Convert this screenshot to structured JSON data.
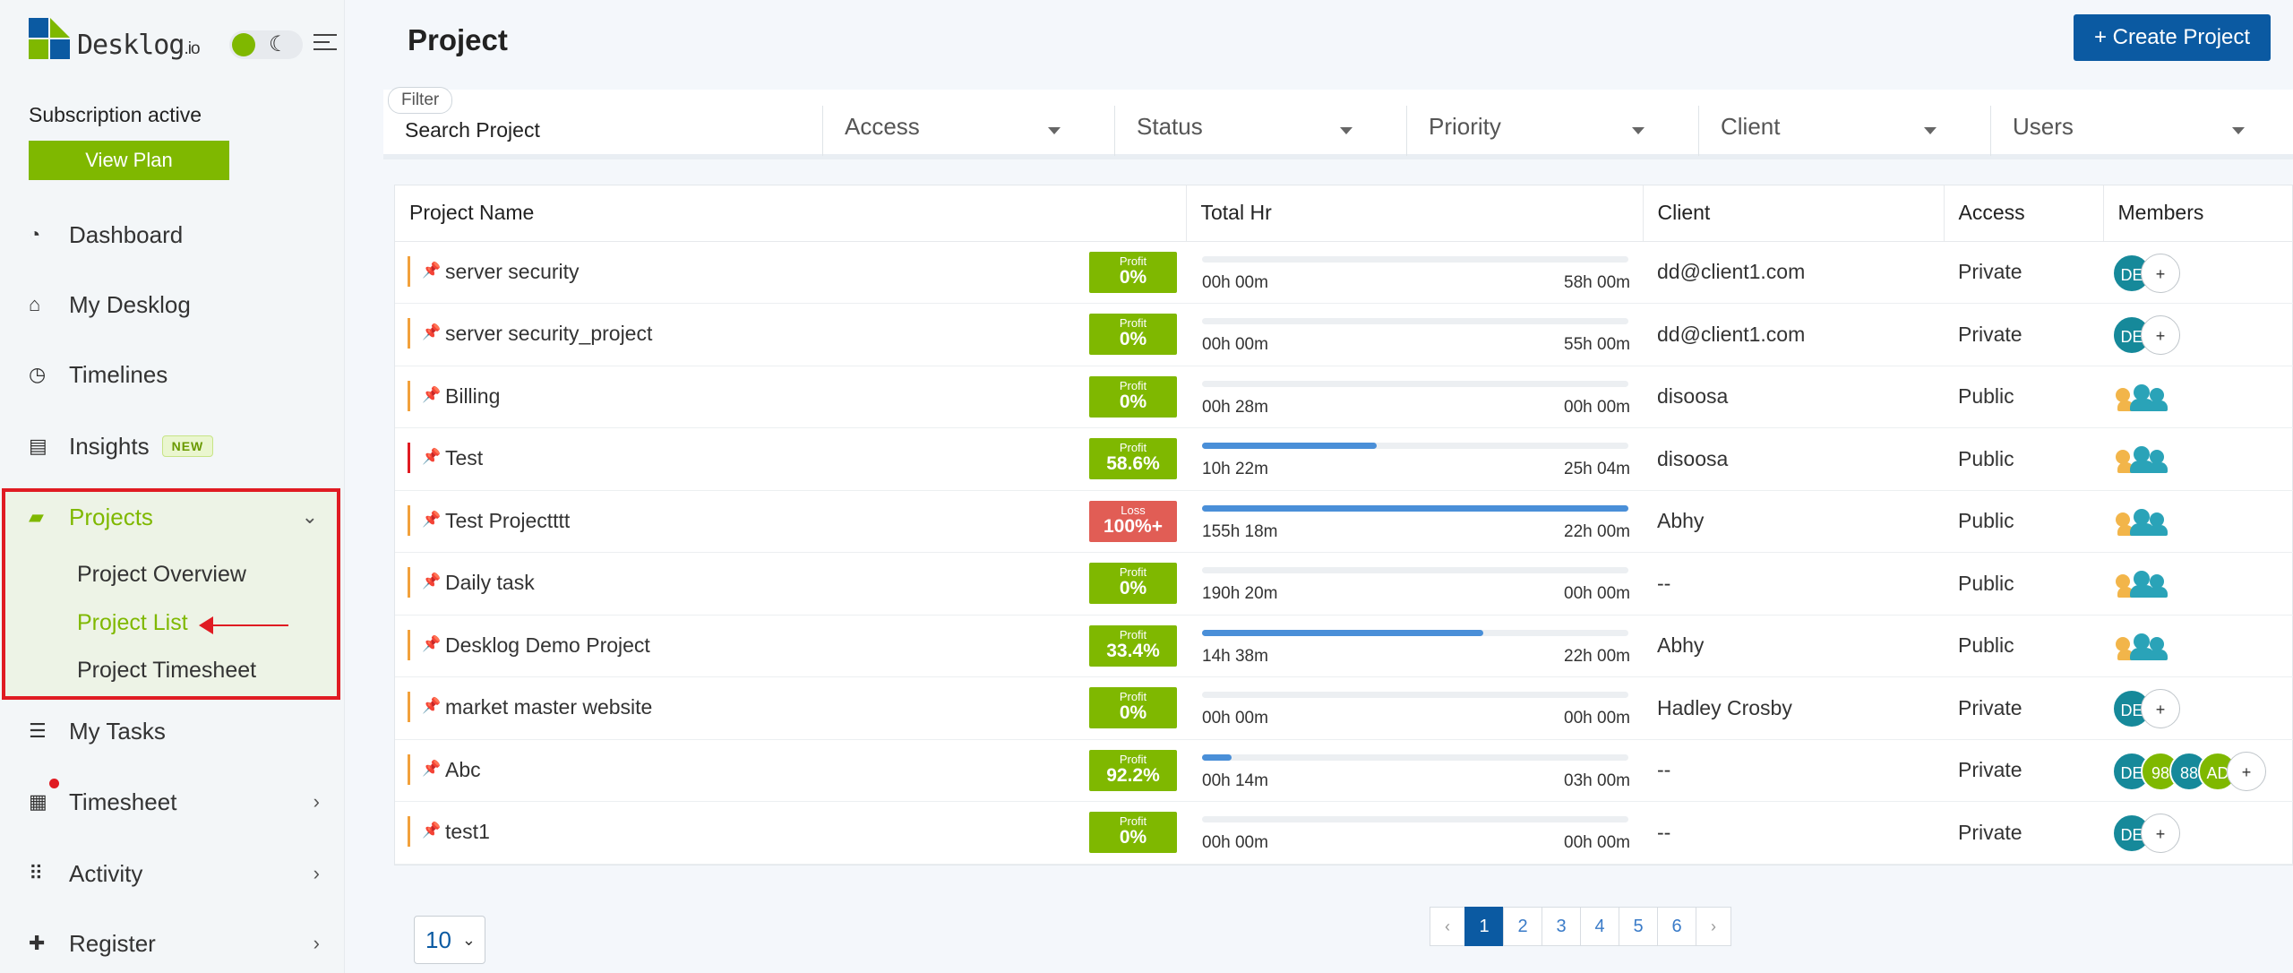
{
  "brand": {
    "name": "Desklog",
    "tld": ".io"
  },
  "sidebar": {
    "subscription_status": "Subscription active",
    "view_plan_label": "View Plan",
    "items": [
      {
        "label": "Dashboard",
        "icon": "dashboard-icon"
      },
      {
        "label": "My Desklog",
        "icon": "home-icon"
      },
      {
        "label": "Timelines",
        "icon": "clock-icon"
      },
      {
        "label": "Insights",
        "icon": "book-icon",
        "badge": "NEW"
      },
      {
        "label": "Projects",
        "icon": "projects-icon"
      },
      {
        "label": "My Tasks",
        "icon": "tasks-icon"
      },
      {
        "label": "Timesheet",
        "icon": "timesheet-icon"
      },
      {
        "label": "Activity",
        "icon": "grid-icon"
      },
      {
        "label": "Register",
        "icon": "plus-icon"
      }
    ],
    "projects_sub": [
      "Project Overview",
      "Project List",
      "Project Timesheet"
    ]
  },
  "header": {
    "title": "Project",
    "create_label": "+ Create Project"
  },
  "filters": {
    "tag": "Filter",
    "search_placeholder": "Search Project",
    "selects": [
      "Access",
      "Status",
      "Priority",
      "Client",
      "Users"
    ]
  },
  "table": {
    "columns": [
      "Project Name",
      "Total Hr",
      "Client",
      "Access",
      "Members"
    ],
    "rows": [
      {
        "name": "server security",
        "badge_type": "Profit",
        "badge_value": "0%",
        "spent": "00h 00m",
        "estimate": "58h 00m",
        "progress": 0,
        "client": "dd@client1.com",
        "access": "Private",
        "members": [
          "DE"
        ]
      },
      {
        "name": "server security_project",
        "badge_type": "Profit",
        "badge_value": "0%",
        "spent": "00h 00m",
        "estimate": "55h 00m",
        "progress": 0,
        "client": "dd@client1.com",
        "access": "Private",
        "members": [
          "DE"
        ]
      },
      {
        "name": "Billing",
        "badge_type": "Profit",
        "badge_value": "0%",
        "spent": "00h 28m",
        "estimate": "00h 00m",
        "progress": 0,
        "client": "disoosa",
        "access": "Public",
        "members": []
      },
      {
        "name": "Test",
        "badge_type": "Profit",
        "badge_value": "58.6%",
        "spent": "10h 22m",
        "estimate": "25h 04m",
        "progress": 0.41,
        "client": "disoosa",
        "access": "Public",
        "members": []
      },
      {
        "name": "Test Projectttt",
        "badge_type": "Loss",
        "badge_value": "100%+",
        "spent": "155h 18m",
        "estimate": "22h 00m",
        "progress": 1,
        "client": "Abhy",
        "access": "Public",
        "members": []
      },
      {
        "name": "Daily task",
        "badge_type": "Profit",
        "badge_value": "0%",
        "spent": "190h 20m",
        "estimate": "00h 00m",
        "progress": 0,
        "client": "--",
        "access": "Public",
        "members": []
      },
      {
        "name": "Desklog Demo Project",
        "badge_type": "Profit",
        "badge_value": "33.4%",
        "spent": "14h 38m",
        "estimate": "22h 00m",
        "progress": 0.66,
        "client": "Abhy",
        "access": "Public",
        "members": []
      },
      {
        "name": "market master website",
        "badge_type": "Profit",
        "badge_value": "0%",
        "spent": "00h 00m",
        "estimate": "00h 00m",
        "progress": 0,
        "client": "Hadley Crosby",
        "access": "Private",
        "members": [
          "DE"
        ]
      },
      {
        "name": "Abc",
        "badge_type": "Profit",
        "badge_value": "92.2%",
        "spent": "00h 14m",
        "estimate": "03h 00m",
        "progress": 0.07,
        "client": "--",
        "access": "Private",
        "members": [
          "DE",
          "98",
          "88",
          "AD"
        ]
      },
      {
        "name": "test1",
        "badge_type": "Profit",
        "badge_value": "0%",
        "spent": "00h 00m",
        "estimate": "00h 00m",
        "progress": 0,
        "client": "--",
        "access": "Private",
        "members": [
          "DE"
        ]
      }
    ]
  },
  "pagination": {
    "per_page": "10",
    "pages": [
      "1",
      "2",
      "3",
      "4",
      "5",
      "6"
    ],
    "prev": "‹",
    "next": "›",
    "active": "1"
  },
  "colors": {
    "accent_green": "#7fb800",
    "primary_blue": "#0b5aa2",
    "loss_red": "#e15d55",
    "progress_blue": "#4a8fd8"
  }
}
